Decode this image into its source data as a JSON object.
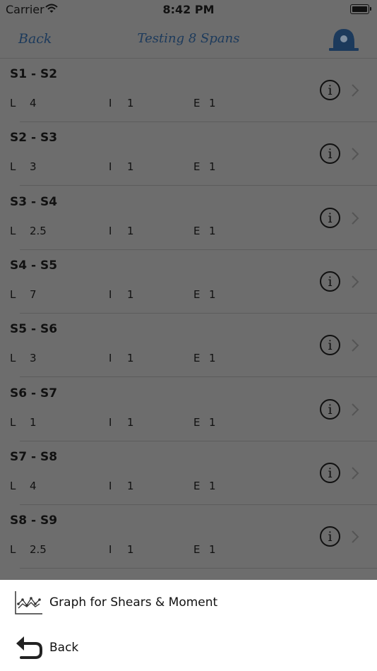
{
  "status_bar": {
    "carrier": "Carrier",
    "time": "8:42 PM"
  },
  "nav": {
    "back_label": "Back",
    "title": "Testing 8 Spans",
    "bell_icon": "bell-icon"
  },
  "labels": {
    "l": "L",
    "i": "I",
    "e": "E"
  },
  "spans": [
    {
      "title": "S1 - S2",
      "L": "4",
      "I": "1",
      "E": "1"
    },
    {
      "title": "S2 - S3",
      "L": "3",
      "I": "1",
      "E": "1"
    },
    {
      "title": "S3 - S4",
      "L": "2.5",
      "I": "1",
      "E": "1"
    },
    {
      "title": "S4 - S5",
      "L": "7",
      "I": "1",
      "E": "1"
    },
    {
      "title": "S5 - S6",
      "L": "3",
      "I": "1",
      "E": "1"
    },
    {
      "title": "S6 - S7",
      "L": "1",
      "I": "1",
      "E": "1"
    },
    {
      "title": "S7 - S8",
      "L": "4",
      "I": "1",
      "E": "1"
    },
    {
      "title": "S8 - S9",
      "L": "2.5",
      "I": "1",
      "E": "1"
    }
  ],
  "action_sheet": {
    "graph_label": "Graph for Shears & Moment",
    "graph_icon": "graph-icon",
    "back_label": "Back",
    "back_icon": "back-arrow-icon"
  },
  "colors": {
    "overlay_bg": "#6d6d6d",
    "nav_text": "#1c3a5c",
    "bell": "#1c3a5c",
    "sheet_bg": "#ffffff"
  }
}
